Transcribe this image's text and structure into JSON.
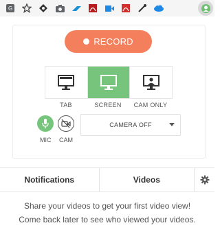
{
  "toolbar": {
    "icons": [
      "translate-icon",
      "star-icon",
      "puzzle-icon",
      "camera-icon",
      "arrow-icon",
      "pdf-icon",
      "video-icon",
      "pdf-icon",
      "eyedropper-icon",
      "cloud-icon",
      "recorder-extension-icon"
    ]
  },
  "recorder": {
    "record_label": "RECORD",
    "modes": [
      {
        "label": "TAB",
        "icon": "monitor-tab-icon"
      },
      {
        "label": "SCREEN",
        "icon": "monitor-screen-icon",
        "active": true
      },
      {
        "label": "CAM ONLY",
        "icon": "monitor-person-icon"
      }
    ],
    "mic_label": "MIC",
    "cam_label": "CAM",
    "camera_select_value": "CAMERA OFF"
  },
  "tabs": {
    "notifications": "Notifications",
    "videos": "Videos"
  },
  "message": {
    "line1": "Share your videos to get your first video view!",
    "line2": "Come back later to see who viewed your videos."
  },
  "colors": {
    "record": "#f47f5d",
    "active_green": "#77c47d",
    "toolbar_bg": "#f5f5f5"
  }
}
